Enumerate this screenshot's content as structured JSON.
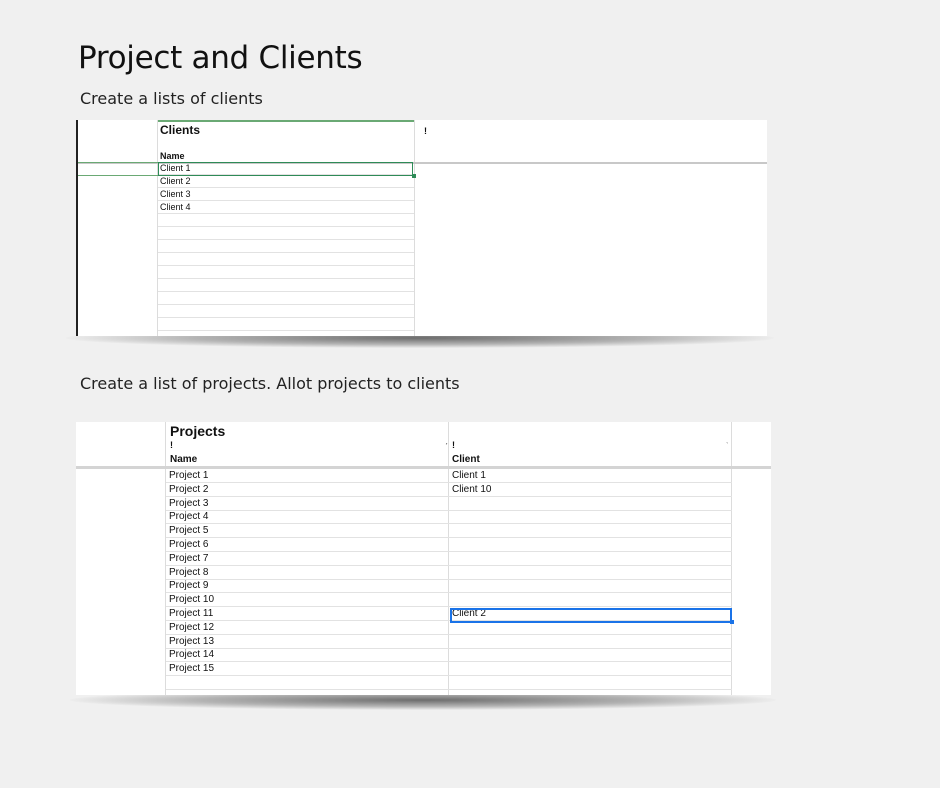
{
  "page": {
    "title": "Project and Clients",
    "step1": "Create a lists of clients",
    "step2": "Create a list of projects. Allot projects to clients"
  },
  "clients_sheet": {
    "title": "Clients",
    "marker": "!",
    "column_header": "Name",
    "rows": [
      "Client 1",
      "Client 2",
      "Client 3",
      "Client 4"
    ],
    "selected_row": "Client 1",
    "selection_color": "#2e8b57"
  },
  "projects_sheet": {
    "title": "Projects",
    "marker": "!",
    "columns": {
      "name": "Name",
      "client": "Client"
    },
    "rows": [
      {
        "name": "Project 1",
        "client": "Client 1"
      },
      {
        "name": "Project 2",
        "client": "Client 10"
      },
      {
        "name": "Project 3",
        "client": ""
      },
      {
        "name": "Project 4",
        "client": ""
      },
      {
        "name": "Project 5",
        "client": ""
      },
      {
        "name": "Project 6",
        "client": ""
      },
      {
        "name": "Project 7",
        "client": ""
      },
      {
        "name": "Project 8",
        "client": ""
      },
      {
        "name": "Project 9",
        "client": ""
      },
      {
        "name": "Project 10",
        "client": ""
      },
      {
        "name": "Project 11",
        "client": "Client 2"
      },
      {
        "name": "Project 12",
        "client": ""
      },
      {
        "name": "Project 13",
        "client": ""
      },
      {
        "name": "Project 14",
        "client": ""
      },
      {
        "name": "Project 15",
        "client": ""
      },
      {
        "name": "",
        "client": ""
      }
    ],
    "dropdown_icon": "caret-down-icon",
    "selected_cell": "Client 2",
    "selection_color": "#1a73e8"
  }
}
